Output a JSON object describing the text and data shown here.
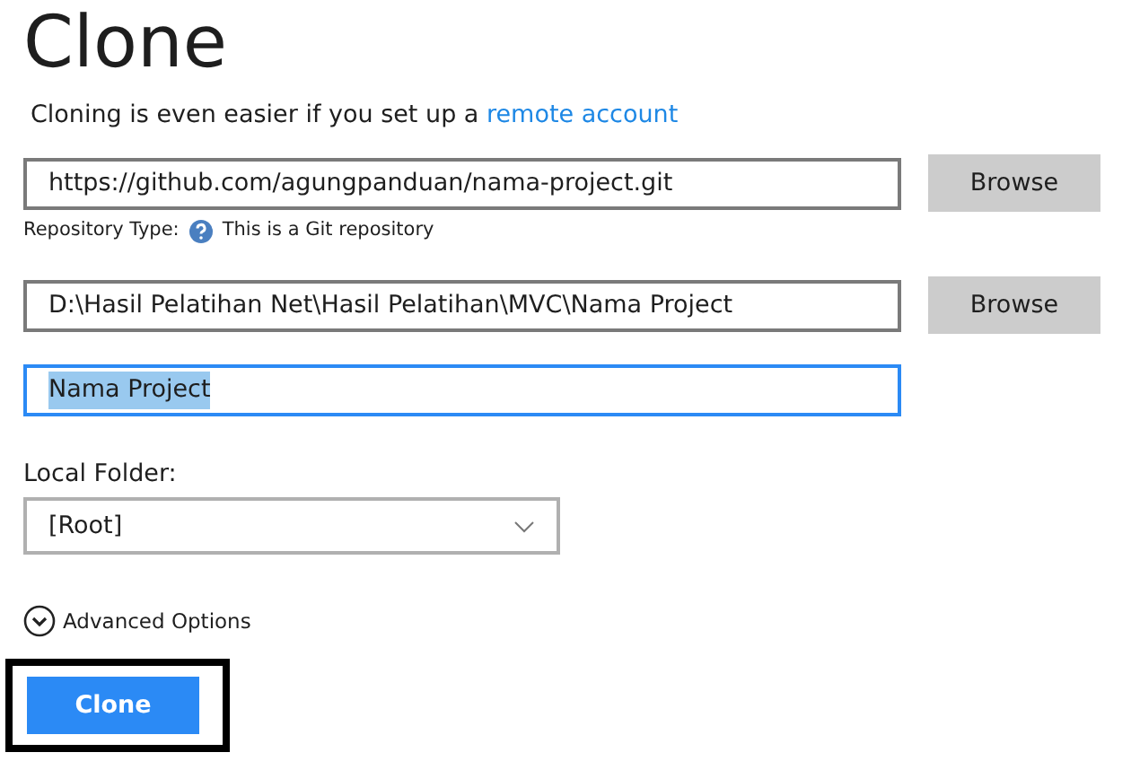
{
  "title": "Clone",
  "subtitle": {
    "text": "Cloning is even easier if you set up a",
    "link": "remote account"
  },
  "repository_url": {
    "value": "https://github.com/agungpanduan/nama-project.git",
    "browse": "Browse"
  },
  "repository_type": {
    "label": "Repository Type:",
    "value": "This is a Git repository"
  },
  "local_path": {
    "value": "D:\\Hasil Pelatihan Net\\Hasil Pelatihan\\MVC\\Nama Project",
    "browse": "Browse"
  },
  "name_field": {
    "value": "Nama Project",
    "text_selected": true,
    "focused": true
  },
  "local_folder": {
    "label": "Local Folder:",
    "value": "[Root]"
  },
  "advanced_options": {
    "label": "Advanced Options",
    "expanded": false
  },
  "clone_button": {
    "label": "Clone",
    "highlighted": true
  }
}
